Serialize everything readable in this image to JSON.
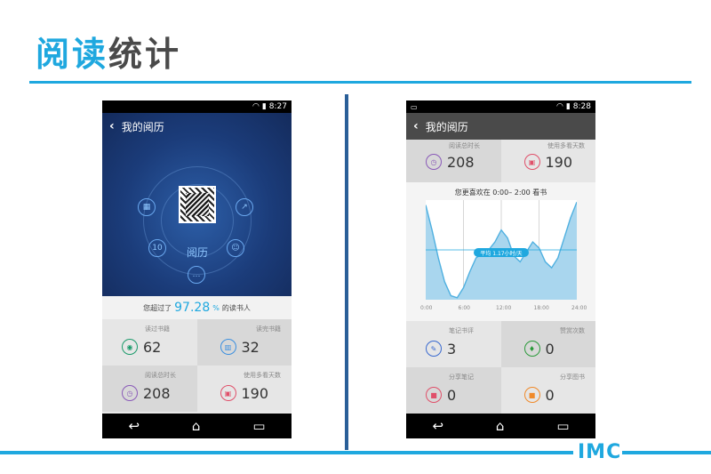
{
  "slide": {
    "title_highlight": "阅读",
    "title_rest": "统计",
    "logo": "IMC"
  },
  "phone_left": {
    "status_time": "8:27",
    "appbar_title": "我的阅历",
    "hero_label": "阅历",
    "percent_prefix": "您超过了",
    "percent_value": "97.28",
    "percent_unit": "%",
    "percent_suffix": "的读书人",
    "stats": [
      {
        "label": "读过书籍",
        "value": "62",
        "icon": "eye-icon",
        "color": "#1a9a6a"
      },
      {
        "label": "读完书籍",
        "value": "32",
        "icon": "book-icon",
        "color": "#3a8fe0"
      },
      {
        "label": "阅读总时长",
        "value": "208",
        "icon": "clock-icon",
        "color": "#8a5ab8"
      },
      {
        "label": "使用多看天数",
        "value": "190",
        "icon": "calendar-icon",
        "color": "#e0506a"
      }
    ]
  },
  "phone_right": {
    "status_time": "8:28",
    "appbar_title": "我的阅历",
    "top_stats": [
      {
        "label": "阅读总时长",
        "value": "208",
        "icon": "clock-icon",
        "color": "#8a5ab8"
      },
      {
        "label": "使用多看天数",
        "value": "190",
        "icon": "calendar-icon",
        "color": "#e0506a"
      }
    ],
    "chart_caption": "您更喜欢在 0:00– 2:00 看书",
    "chart_highlight": "平均 1.17小时/天",
    "bottom_stats": [
      {
        "label": "笔记书评",
        "value": "3",
        "icon": "pen-icon",
        "color": "#3a6ad0"
      },
      {
        "label": "赞赏次数",
        "value": "0",
        "icon": "thumbs-up-icon",
        "color": "#2a9a3a"
      },
      {
        "label": "分享笔记",
        "value": "0",
        "icon": "share-note-icon",
        "color": "#e0506a"
      },
      {
        "label": "分享图书",
        "value": "0",
        "icon": "share-book-icon",
        "color": "#f08a2a"
      }
    ]
  },
  "chart_data": {
    "type": "area",
    "title": "您更喜欢在 0:00– 2:00 看书",
    "xlabel": "",
    "ylabel": "",
    "x_ticks": [
      "0:00",
      "6:00",
      "12:00",
      "18:00",
      "24:00"
    ],
    "x": [
      0,
      1,
      2,
      3,
      4,
      5,
      6,
      7,
      8,
      9,
      10,
      11,
      12,
      13,
      14,
      15,
      16,
      17,
      18,
      19,
      20,
      21,
      22,
      23,
      24
    ],
    "values": [
      95,
      70,
      42,
      18,
      4,
      2,
      12,
      28,
      42,
      46,
      50,
      58,
      70,
      62,
      44,
      38,
      48,
      58,
      52,
      38,
      32,
      42,
      62,
      82,
      98
    ],
    "reference_line": 50,
    "ylim": [
      0,
      100
    ],
    "grid": true,
    "color": "#4fb0e0"
  }
}
